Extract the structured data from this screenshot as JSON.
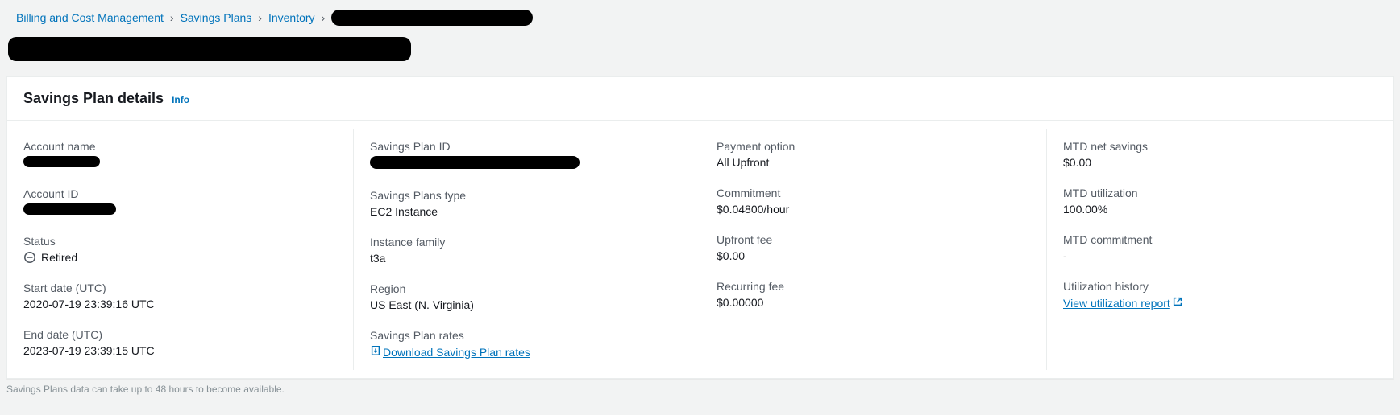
{
  "breadcrumbs": {
    "item1": "Billing and Cost Management",
    "item2": "Savings Plans",
    "item3": "Inventory"
  },
  "panel": {
    "title": "Savings Plan details",
    "info": "Info"
  },
  "col1": {
    "account_name_label": "Account name",
    "account_id_label": "Account ID",
    "status_label": "Status",
    "status_value": "Retired",
    "start_date_label": "Start date (UTC)",
    "start_date_value": "2020-07-19 23:39:16 UTC",
    "end_date_label": "End date (UTC)",
    "end_date_value": "2023-07-19 23:39:15 UTC"
  },
  "col2": {
    "sp_id_label": "Savings Plan ID",
    "sp_type_label": "Savings Plans type",
    "sp_type_value": "EC2 Instance",
    "instance_family_label": "Instance family",
    "instance_family_value": "t3a",
    "region_label": "Region",
    "region_value": "US East (N. Virginia)",
    "sp_rates_label": "Savings Plan rates",
    "sp_rates_link": "Download Savings Plan rates"
  },
  "col3": {
    "payment_option_label": "Payment option",
    "payment_option_value": "All Upfront",
    "commitment_label": "Commitment",
    "commitment_value": "$0.04800/hour",
    "upfront_fee_label": "Upfront fee",
    "upfront_fee_value": "$0.00",
    "recurring_fee_label": "Recurring fee",
    "recurring_fee_value": "$0.00000"
  },
  "col4": {
    "mtd_net_savings_label": "MTD net savings",
    "mtd_net_savings_value": "$0.00",
    "mtd_utilization_label": "MTD utilization",
    "mtd_utilization_value": "100.00%",
    "mtd_commitment_label": "MTD commitment",
    "mtd_commitment_value": "-",
    "utilization_history_label": "Utilization history",
    "utilization_history_link": "View utilization report"
  },
  "footer": {
    "note": "Savings Plans data can take up to 48 hours to become available."
  }
}
